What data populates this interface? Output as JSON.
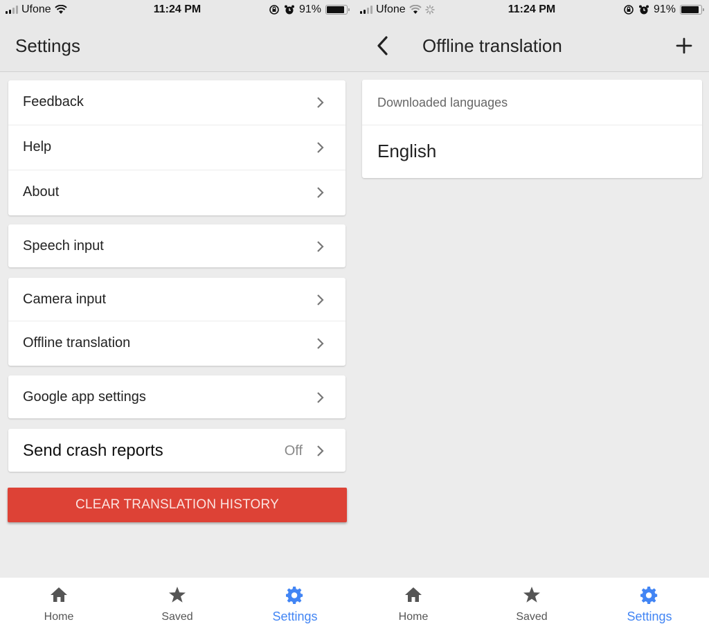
{
  "status_bar": {
    "carrier": "Ufone",
    "time": "11:24 PM",
    "battery_percent_label": "91%",
    "battery_level": 0.91
  },
  "left": {
    "header": {
      "title": "Settings"
    },
    "groups": [
      {
        "items": [
          {
            "label": "Feedback"
          },
          {
            "label": "Help"
          },
          {
            "label": "About"
          }
        ]
      },
      {
        "items": [
          {
            "label": "Speech input"
          }
        ]
      },
      {
        "items": [
          {
            "label": "Camera input"
          },
          {
            "label": "Offline translation"
          }
        ]
      },
      {
        "items": [
          {
            "label": "Google app settings"
          }
        ]
      },
      {
        "items": [
          {
            "label": "Send crash reports",
            "value": "Off"
          }
        ]
      }
    ],
    "clear_button": "CLEAR TRANSLATION HISTORY"
  },
  "right": {
    "header": {
      "title": "Offline translation",
      "back_icon": "chevron-left-icon",
      "add_icon": "plus-icon"
    },
    "section_label": "Downloaded languages",
    "languages": [
      "English"
    ]
  },
  "bottom_nav": {
    "items": [
      {
        "label": "Home",
        "icon": "home-icon",
        "active": false
      },
      {
        "label": "Saved",
        "icon": "star-icon",
        "active": false
      },
      {
        "label": "Settings",
        "icon": "gear-icon",
        "active": true
      }
    ]
  },
  "colors": {
    "accent": "#4285f4",
    "danger": "#dd4236",
    "background": "#ececec"
  }
}
